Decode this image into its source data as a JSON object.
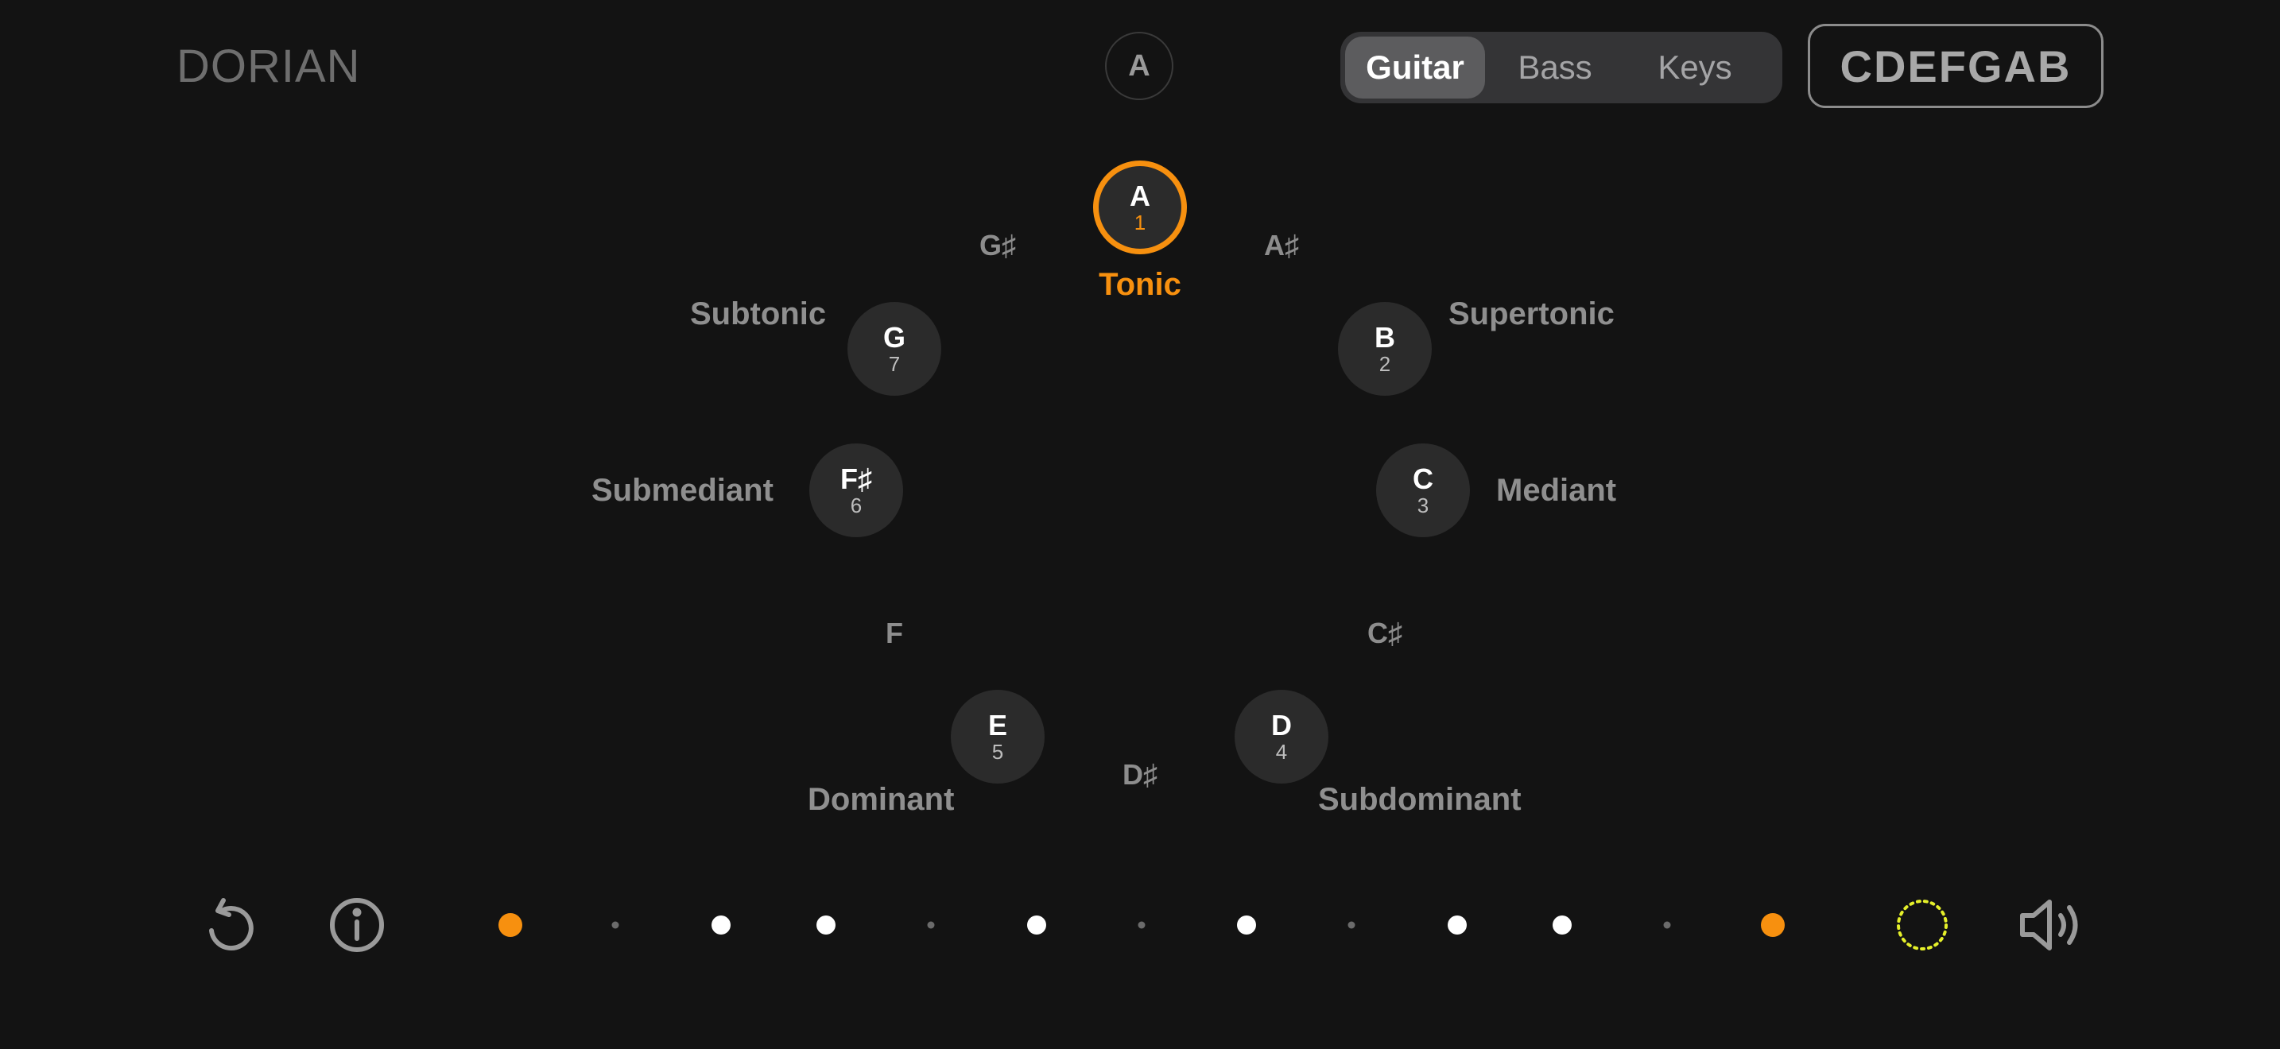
{
  "header": {
    "mode_title": "DORIAN",
    "key_label": "A",
    "instruments": [
      "Guitar",
      "Bass",
      "Keys"
    ],
    "selected_instrument": "Guitar",
    "scale_letters": "CDEFGAB"
  },
  "circle": {
    "notes": [
      {
        "name": "A",
        "degree": "1",
        "function": "Tonic"
      },
      {
        "name": "B",
        "degree": "2",
        "function": "Supertonic"
      },
      {
        "name": "C",
        "degree": "3",
        "function": "Mediant"
      },
      {
        "name": "D",
        "degree": "4",
        "function": "Subdominant"
      },
      {
        "name": "E",
        "degree": "5",
        "function": "Dominant"
      },
      {
        "name": "F♯",
        "degree": "6",
        "function": "Submediant"
      },
      {
        "name": "G",
        "degree": "7",
        "function": "Subtonic"
      }
    ],
    "accidentals": [
      "A♯",
      "C♯",
      "D♯",
      "F",
      "G♯"
    ]
  },
  "colors": {
    "accent": "#f7900f",
    "background": "#131313",
    "note_fill": "#2b2b2b",
    "loading_ring": "#e5f02a"
  },
  "footer": {
    "icons": [
      "reset-icon",
      "info-icon",
      "loading-ring-icon",
      "speaker-icon"
    ],
    "scale_steps": [
      "root",
      "skip",
      "on",
      "on",
      "skip",
      "on",
      "skip",
      "on",
      "skip",
      "on",
      "on",
      "skip",
      "root"
    ]
  }
}
